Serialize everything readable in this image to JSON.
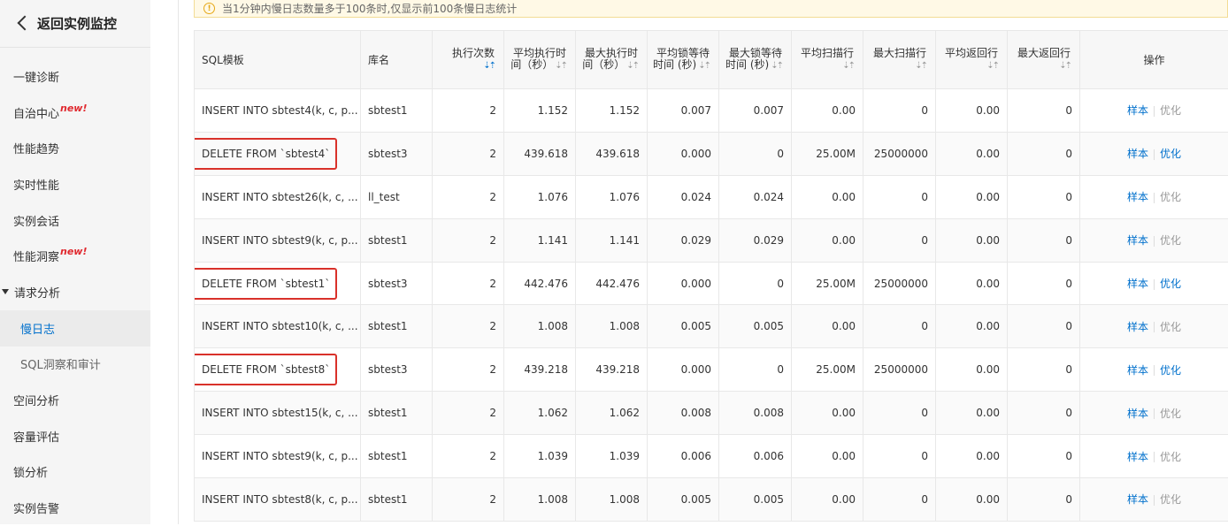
{
  "sidebar": {
    "back_label": "返回实例监控",
    "items": [
      {
        "label": "一键诊断"
      },
      {
        "label": "自治中心",
        "badge": "new!"
      },
      {
        "label": "性能趋势"
      },
      {
        "label": "实时性能"
      },
      {
        "label": "实例会话"
      },
      {
        "label": "性能洞察",
        "badge": "new!"
      },
      {
        "label": "请求分析"
      },
      {
        "label": "慢日志"
      },
      {
        "label": "SQL洞察和审计"
      },
      {
        "label": "空间分析"
      },
      {
        "label": "容量评估"
      },
      {
        "label": "锁分析"
      },
      {
        "label": "实例告警"
      }
    ],
    "active_color": "#0070cc",
    "badge_color": "#e0282e"
  },
  "notice": {
    "icon": "warning-icon",
    "text": "当1分钟内慢日志数量多于100条时,仅显示前100条慢日志统计"
  },
  "table": {
    "headers": {
      "sql": "SQL模板",
      "db": "库名",
      "exec_count": "执行次数",
      "avg_exec_1": "平均执行时",
      "avg_exec_2": "间（秒）",
      "max_exec_1": "最大执行时",
      "max_exec_2": "间（秒）",
      "avg_lock_1": "平均锁等待",
      "avg_lock_2": "时间 (秒)",
      "max_lock_1": "最大锁等待",
      "max_lock_2": "时间 (秒)",
      "avg_scan": "平均扫描行",
      "max_scan": "最大扫描行",
      "avg_return": "平均返回行",
      "max_return": "最大返回行",
      "ops": "操作"
    },
    "sort_icon": "⇣⇡",
    "op_sample": "样本",
    "op_optimize": "优化",
    "rows": [
      {
        "sql": "INSERT INTO sbtest4(k, c, p...",
        "db": "sbtest1",
        "exec": "2",
        "avg_exec": "1.152",
        "max_exec": "1.152",
        "avg_lock": "0.007",
        "max_lock": "0.007",
        "avg_scan": "0.00",
        "max_scan": "0",
        "avg_ret": "0.00",
        "max_ret": "0",
        "highlighted": false,
        "optimize_enabled": false
      },
      {
        "sql": "DELETE FROM `sbtest4`",
        "db": "sbtest3",
        "exec": "2",
        "avg_exec": "439.618",
        "max_exec": "439.618",
        "avg_lock": "0.000",
        "max_lock": "0",
        "avg_scan": "25.00M",
        "max_scan": "25000000",
        "avg_ret": "0.00",
        "max_ret": "0",
        "highlighted": true,
        "optimize_enabled": true
      },
      {
        "sql": "INSERT INTO sbtest26(k, c, ...",
        "db": "ll_test",
        "exec": "2",
        "avg_exec": "1.076",
        "max_exec": "1.076",
        "avg_lock": "0.024",
        "max_lock": "0.024",
        "avg_scan": "0.00",
        "max_scan": "0",
        "avg_ret": "0.00",
        "max_ret": "0",
        "highlighted": false,
        "optimize_enabled": false
      },
      {
        "sql": "INSERT INTO sbtest9(k, c, p...",
        "db": "sbtest1",
        "exec": "2",
        "avg_exec": "1.141",
        "max_exec": "1.141",
        "avg_lock": "0.029",
        "max_lock": "0.029",
        "avg_scan": "0.00",
        "max_scan": "0",
        "avg_ret": "0.00",
        "max_ret": "0",
        "highlighted": false,
        "optimize_enabled": false
      },
      {
        "sql": "DELETE FROM `sbtest1`",
        "db": "sbtest3",
        "exec": "2",
        "avg_exec": "442.476",
        "max_exec": "442.476",
        "avg_lock": "0.000",
        "max_lock": "0",
        "avg_scan": "25.00M",
        "max_scan": "25000000",
        "avg_ret": "0.00",
        "max_ret": "0",
        "highlighted": true,
        "optimize_enabled": true
      },
      {
        "sql": "INSERT INTO sbtest10(k, c, ...",
        "db": "sbtest1",
        "exec": "2",
        "avg_exec": "1.008",
        "max_exec": "1.008",
        "avg_lock": "0.005",
        "max_lock": "0.005",
        "avg_scan": "0.00",
        "max_scan": "0",
        "avg_ret": "0.00",
        "max_ret": "0",
        "highlighted": false,
        "optimize_enabled": false
      },
      {
        "sql": "DELETE FROM `sbtest8`",
        "db": "sbtest3",
        "exec": "2",
        "avg_exec": "439.218",
        "max_exec": "439.218",
        "avg_lock": "0.000",
        "max_lock": "0",
        "avg_scan": "25.00M",
        "max_scan": "25000000",
        "avg_ret": "0.00",
        "max_ret": "0",
        "highlighted": true,
        "optimize_enabled": true
      },
      {
        "sql": "INSERT INTO sbtest15(k, c, ...",
        "db": "sbtest1",
        "exec": "2",
        "avg_exec": "1.062",
        "max_exec": "1.062",
        "avg_lock": "0.008",
        "max_lock": "0.008",
        "avg_scan": "0.00",
        "max_scan": "0",
        "avg_ret": "0.00",
        "max_ret": "0",
        "highlighted": false,
        "optimize_enabled": false
      },
      {
        "sql": "INSERT INTO sbtest9(k, c, p...",
        "db": "sbtest1",
        "exec": "2",
        "avg_exec": "1.039",
        "max_exec": "1.039",
        "avg_lock": "0.006",
        "max_lock": "0.006",
        "avg_scan": "0.00",
        "max_scan": "0",
        "avg_ret": "0.00",
        "max_ret": "0",
        "highlighted": false,
        "optimize_enabled": false
      },
      {
        "sql": "INSERT INTO sbtest8(k, c, p...",
        "db": "sbtest1",
        "exec": "2",
        "avg_exec": "1.008",
        "max_exec": "1.008",
        "avg_lock": "0.005",
        "max_lock": "0.005",
        "avg_scan": "0.00",
        "max_scan": "0",
        "avg_ret": "0.00",
        "max_ret": "0",
        "highlighted": false,
        "optimize_enabled": false
      }
    ],
    "highlight_color": "#d9312a"
  }
}
